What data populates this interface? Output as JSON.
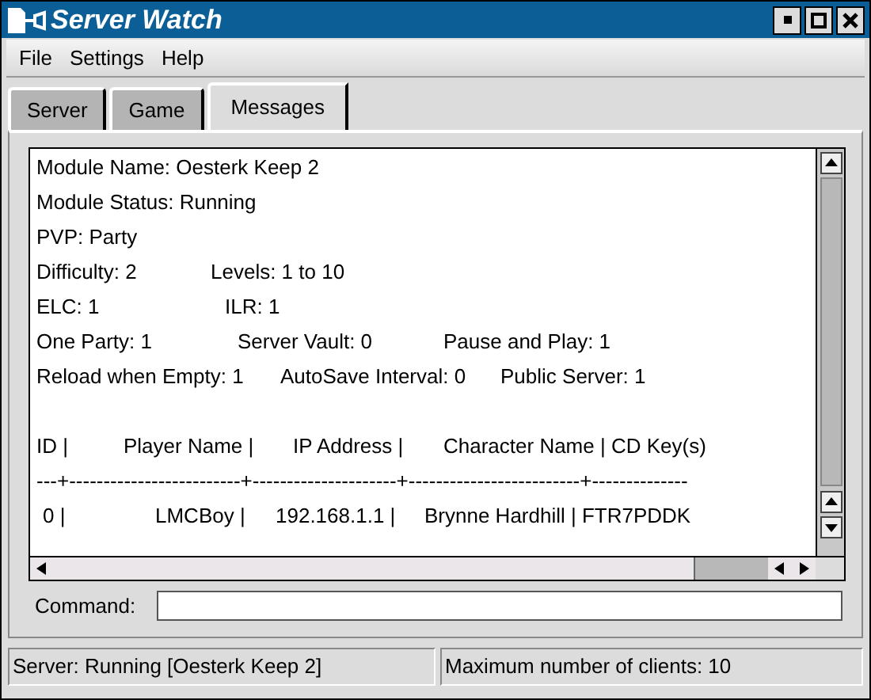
{
  "window": {
    "title": "Server Watch"
  },
  "menu": [
    {
      "label": "File"
    },
    {
      "label": "Settings"
    },
    {
      "label": "Help"
    }
  ],
  "tabs": [
    {
      "label": "Server",
      "selected": false
    },
    {
      "label": "Game",
      "selected": false
    },
    {
      "label": "Messages",
      "selected": true
    }
  ],
  "messages": [
    {
      "segments": [
        "Module Name: Oesterk Keep 2"
      ]
    },
    {
      "segments": [
        "Module Status: Running"
      ]
    },
    {
      "segments": [
        "PVP: Party"
      ]
    },
    {
      "segments": [
        "Difficulty: 2",
        "Levels: 1 to 10"
      ]
    },
    {
      "segments": [
        "ELC: 1",
        "ILR: 1"
      ]
    },
    {
      "segments": [
        "One Party: 1",
        "Server Vault: 0",
        "Pause and Play: 1"
      ]
    },
    {
      "segments": [
        "Reload when Empty: 1",
        "AutoSave Interval: 0",
        "Public Server: 1"
      ]
    },
    {
      "segments": [
        "ID |",
        "Player Name |",
        "IP Address |",
        "Character Name | CD Key(s)"
      ]
    },
    {
      "segments": [
        "---+-------------------------+---------------------+-------------------------+--------------"
      ]
    },
    {
      "segments": [
        "0 |",
        "LMCBoy |",
        "192.168.1.1 |",
        "Brynne Hardhill | FTR7PDDK"
      ]
    }
  ],
  "command": {
    "label": "Command:"
  },
  "status_bar": [
    "Server: Running [Oesterk Keep 2]",
    "Maximum number of clients: 10"
  ]
}
